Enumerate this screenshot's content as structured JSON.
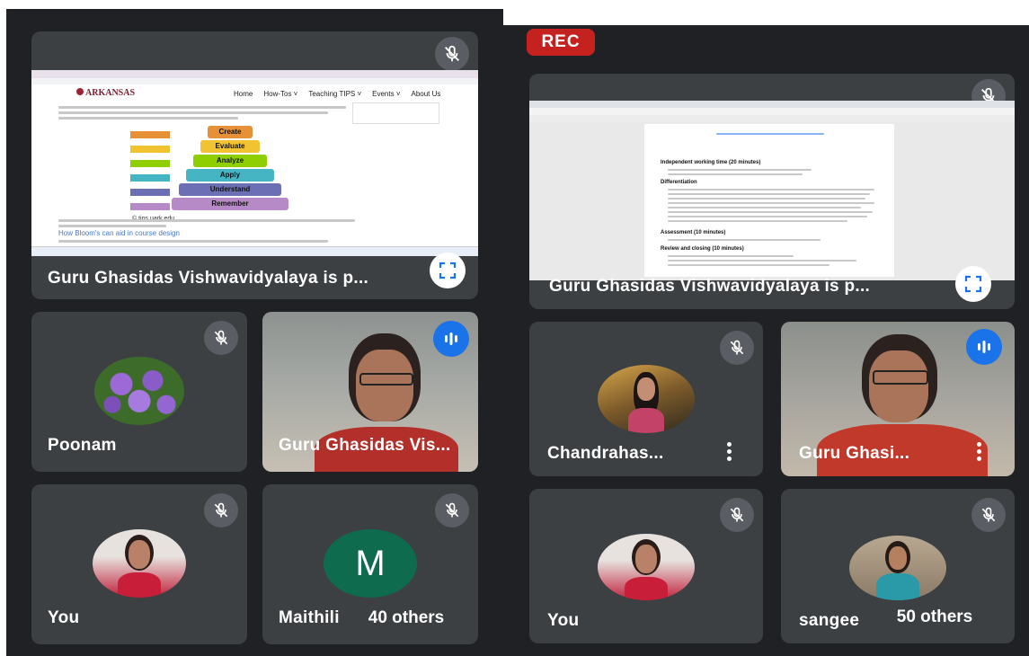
{
  "recording": {
    "label": "REC"
  },
  "left": {
    "presenter": {
      "name": "Guru Ghasidas Vishwavidyalaya is p...",
      "site": {
        "brand": "ARKANSAS",
        "nav": [
          "Home",
          "How-Tos ˅",
          "Teaching TIPS ˅",
          "Events ˅",
          "About Us"
        ],
        "pyramid": [
          "Create",
          "Evaluate",
          "Analyze",
          "Apply",
          "Understand",
          "Remember"
        ],
        "caption": "© tips.uark.edu",
        "heading": "How Bloom's can aid in course design"
      }
    },
    "tiles": [
      {
        "name": "Poonam"
      },
      {
        "name": "Guru Ghasidas Vis..."
      },
      {
        "name": "You"
      },
      {
        "name": "Maithili",
        "initial": "M",
        "others": "40 others"
      }
    ]
  },
  "right": {
    "presenter": {
      "name": "Guru Ghasidas Vishwavidyalaya is p...",
      "doc": {
        "sections": [
          "Independent working time (20 minutes)",
          "Differentiation",
          "Assessment (10 minutes)",
          "Review and closing (10 minutes)"
        ]
      }
    },
    "tiles": [
      {
        "name": "Chandrahas..."
      },
      {
        "name": "Guru Ghasi..."
      },
      {
        "name": "You"
      },
      {
        "name": "sangee",
        "others": "50 others"
      }
    ]
  },
  "colors": {
    "bg": "#202124",
    "tile": "#3c4043",
    "rec": "#c5221f",
    "speaking": "#1a73e8"
  }
}
